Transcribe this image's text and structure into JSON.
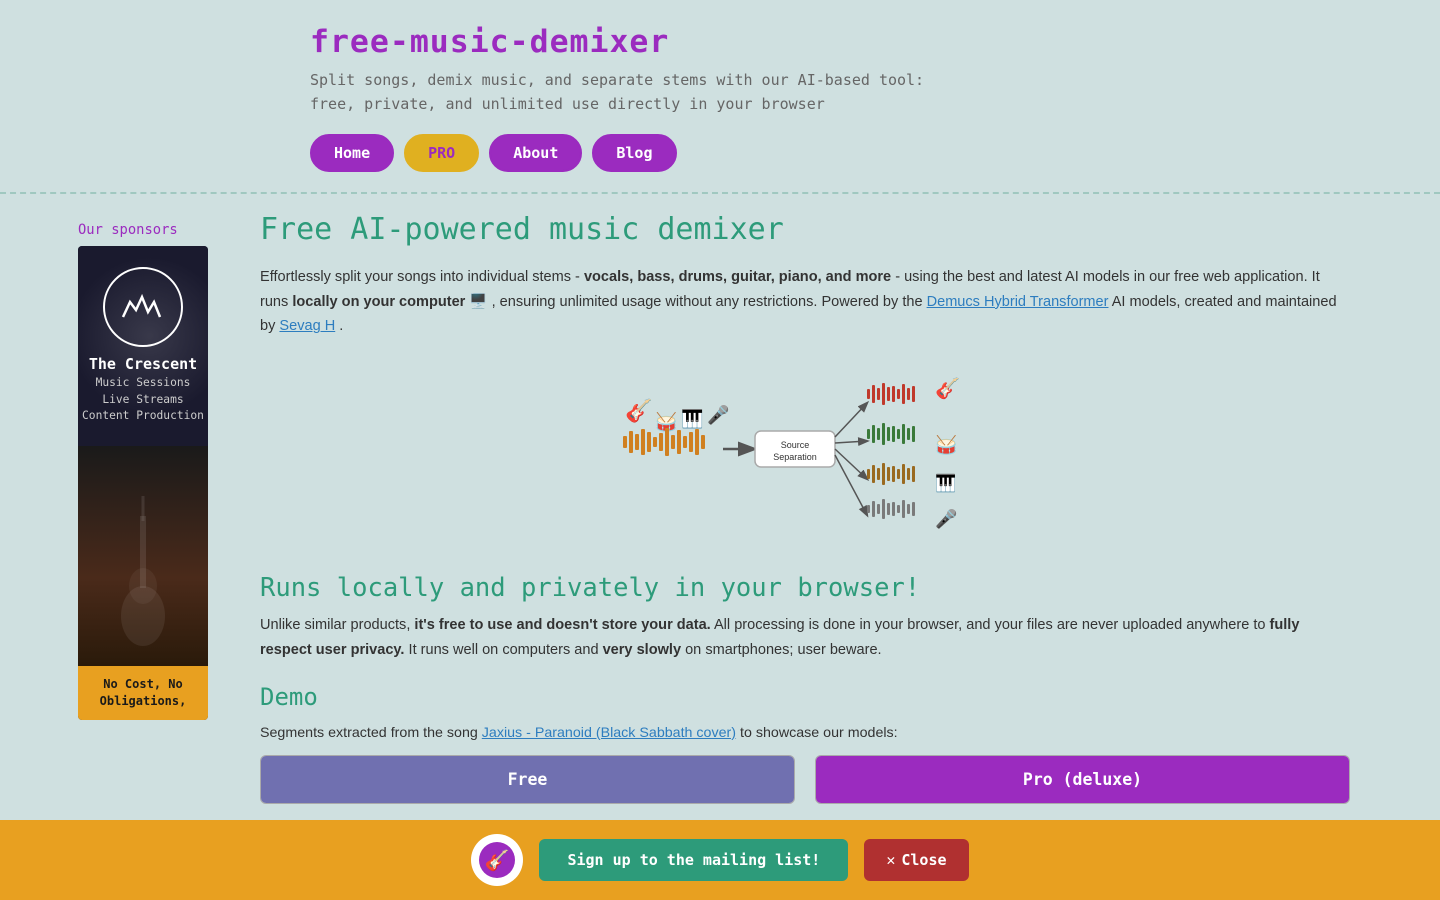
{
  "header": {
    "title": "free-music-demixer",
    "subtitle_line1": "Split songs, demix music, and separate stems with our AI-based tool:",
    "subtitle_line2": "free, private, and unlimited use directly in your browser",
    "nav": {
      "home": "Home",
      "pro": "PRO",
      "about": "About",
      "blog": "Blog"
    }
  },
  "sidebar": {
    "sponsors_label": "Our sponsors",
    "sponsor": {
      "name": "The Crescent",
      "line1": "Music Sessions",
      "line2": "Live Streams",
      "line3": "Content Production",
      "cta_line1": "No Cost, No",
      "cta_line2": "Obligations,"
    }
  },
  "main": {
    "heading": "Free AI-powered music demixer",
    "para1_pre": "Effortlessly split your songs into individual stems -",
    "para1_bold": "vocals, bass, drums, guitar, piano, and more",
    "para1_mid": "- using the best and latest AI models in our free web application. It runs",
    "para1_bold2": "locally on your computer",
    "para1_emoji": "🖥️",
    "para1_end": ", ensuring unlimited usage without any restrictions. Powered by the",
    "para1_link": "Demucs Hybrid Transformer",
    "para1_end2": "AI models, created and maintained by",
    "para1_link2": "Sevag H",
    "para1_end3": ".",
    "section1_heading": "Runs locally and privately in your browser!",
    "para2_pre": "Unlike similar products,",
    "para2_bold": "it's free to use and doesn't store your data.",
    "para2_mid": "All processing is done in your browser, and your files are never uploaded anywhere to",
    "para2_bold2": "fully respect user privacy.",
    "para2_end": "It runs well on computers and",
    "para2_bold3": "very slowly",
    "para2_end2": "on smartphones; user beware.",
    "demo_heading": "Demo",
    "demo_para": "Segments extracted from the song Jaxius - Paranoid (Black Sabbath cover) to showcase our models:",
    "demo_link": "Jaxius - Paranoid (Black Sabbath cover)",
    "demo_col_free": "Free",
    "demo_col_pro": "Pro (deluxe)"
  },
  "notif": {
    "signup_label": "Sign up to the mailing list!",
    "close_label": "Close"
  },
  "icons": {
    "close": "✕"
  }
}
